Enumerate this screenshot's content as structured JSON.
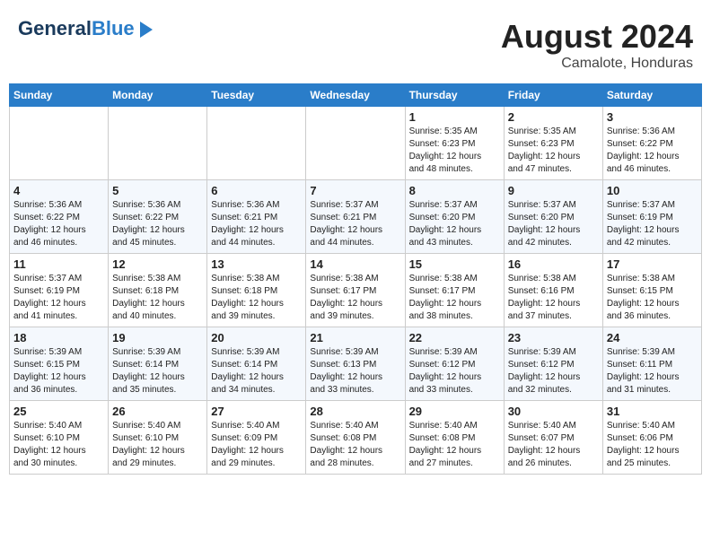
{
  "header": {
    "logo_line1": "General",
    "logo_line2": "Blue",
    "month_year": "August 2024",
    "location": "Camalote, Honduras"
  },
  "days_of_week": [
    "Sunday",
    "Monday",
    "Tuesday",
    "Wednesday",
    "Thursday",
    "Friday",
    "Saturday"
  ],
  "weeks": [
    [
      {
        "day": "",
        "info": ""
      },
      {
        "day": "",
        "info": ""
      },
      {
        "day": "",
        "info": ""
      },
      {
        "day": "",
        "info": ""
      },
      {
        "day": "1",
        "info": "Sunrise: 5:35 AM\nSunset: 6:23 PM\nDaylight: 12 hours\nand 48 minutes."
      },
      {
        "day": "2",
        "info": "Sunrise: 5:35 AM\nSunset: 6:23 PM\nDaylight: 12 hours\nand 47 minutes."
      },
      {
        "day": "3",
        "info": "Sunrise: 5:36 AM\nSunset: 6:22 PM\nDaylight: 12 hours\nand 46 minutes."
      }
    ],
    [
      {
        "day": "4",
        "info": "Sunrise: 5:36 AM\nSunset: 6:22 PM\nDaylight: 12 hours\nand 46 minutes."
      },
      {
        "day": "5",
        "info": "Sunrise: 5:36 AM\nSunset: 6:22 PM\nDaylight: 12 hours\nand 45 minutes."
      },
      {
        "day": "6",
        "info": "Sunrise: 5:36 AM\nSunset: 6:21 PM\nDaylight: 12 hours\nand 44 minutes."
      },
      {
        "day": "7",
        "info": "Sunrise: 5:37 AM\nSunset: 6:21 PM\nDaylight: 12 hours\nand 44 minutes."
      },
      {
        "day": "8",
        "info": "Sunrise: 5:37 AM\nSunset: 6:20 PM\nDaylight: 12 hours\nand 43 minutes."
      },
      {
        "day": "9",
        "info": "Sunrise: 5:37 AM\nSunset: 6:20 PM\nDaylight: 12 hours\nand 42 minutes."
      },
      {
        "day": "10",
        "info": "Sunrise: 5:37 AM\nSunset: 6:19 PM\nDaylight: 12 hours\nand 42 minutes."
      }
    ],
    [
      {
        "day": "11",
        "info": "Sunrise: 5:37 AM\nSunset: 6:19 PM\nDaylight: 12 hours\nand 41 minutes."
      },
      {
        "day": "12",
        "info": "Sunrise: 5:38 AM\nSunset: 6:18 PM\nDaylight: 12 hours\nand 40 minutes."
      },
      {
        "day": "13",
        "info": "Sunrise: 5:38 AM\nSunset: 6:18 PM\nDaylight: 12 hours\nand 39 minutes."
      },
      {
        "day": "14",
        "info": "Sunrise: 5:38 AM\nSunset: 6:17 PM\nDaylight: 12 hours\nand 39 minutes."
      },
      {
        "day": "15",
        "info": "Sunrise: 5:38 AM\nSunset: 6:17 PM\nDaylight: 12 hours\nand 38 minutes."
      },
      {
        "day": "16",
        "info": "Sunrise: 5:38 AM\nSunset: 6:16 PM\nDaylight: 12 hours\nand 37 minutes."
      },
      {
        "day": "17",
        "info": "Sunrise: 5:38 AM\nSunset: 6:15 PM\nDaylight: 12 hours\nand 36 minutes."
      }
    ],
    [
      {
        "day": "18",
        "info": "Sunrise: 5:39 AM\nSunset: 6:15 PM\nDaylight: 12 hours\nand 36 minutes."
      },
      {
        "day": "19",
        "info": "Sunrise: 5:39 AM\nSunset: 6:14 PM\nDaylight: 12 hours\nand 35 minutes."
      },
      {
        "day": "20",
        "info": "Sunrise: 5:39 AM\nSunset: 6:14 PM\nDaylight: 12 hours\nand 34 minutes."
      },
      {
        "day": "21",
        "info": "Sunrise: 5:39 AM\nSunset: 6:13 PM\nDaylight: 12 hours\nand 33 minutes."
      },
      {
        "day": "22",
        "info": "Sunrise: 5:39 AM\nSunset: 6:12 PM\nDaylight: 12 hours\nand 33 minutes."
      },
      {
        "day": "23",
        "info": "Sunrise: 5:39 AM\nSunset: 6:12 PM\nDaylight: 12 hours\nand 32 minutes."
      },
      {
        "day": "24",
        "info": "Sunrise: 5:39 AM\nSunset: 6:11 PM\nDaylight: 12 hours\nand 31 minutes."
      }
    ],
    [
      {
        "day": "25",
        "info": "Sunrise: 5:40 AM\nSunset: 6:10 PM\nDaylight: 12 hours\nand 30 minutes."
      },
      {
        "day": "26",
        "info": "Sunrise: 5:40 AM\nSunset: 6:10 PM\nDaylight: 12 hours\nand 29 minutes."
      },
      {
        "day": "27",
        "info": "Sunrise: 5:40 AM\nSunset: 6:09 PM\nDaylight: 12 hours\nand 29 minutes."
      },
      {
        "day": "28",
        "info": "Sunrise: 5:40 AM\nSunset: 6:08 PM\nDaylight: 12 hours\nand 28 minutes."
      },
      {
        "day": "29",
        "info": "Sunrise: 5:40 AM\nSunset: 6:08 PM\nDaylight: 12 hours\nand 27 minutes."
      },
      {
        "day": "30",
        "info": "Sunrise: 5:40 AM\nSunset: 6:07 PM\nDaylight: 12 hours\nand 26 minutes."
      },
      {
        "day": "31",
        "info": "Sunrise: 5:40 AM\nSunset: 6:06 PM\nDaylight: 12 hours\nand 25 minutes."
      }
    ]
  ]
}
